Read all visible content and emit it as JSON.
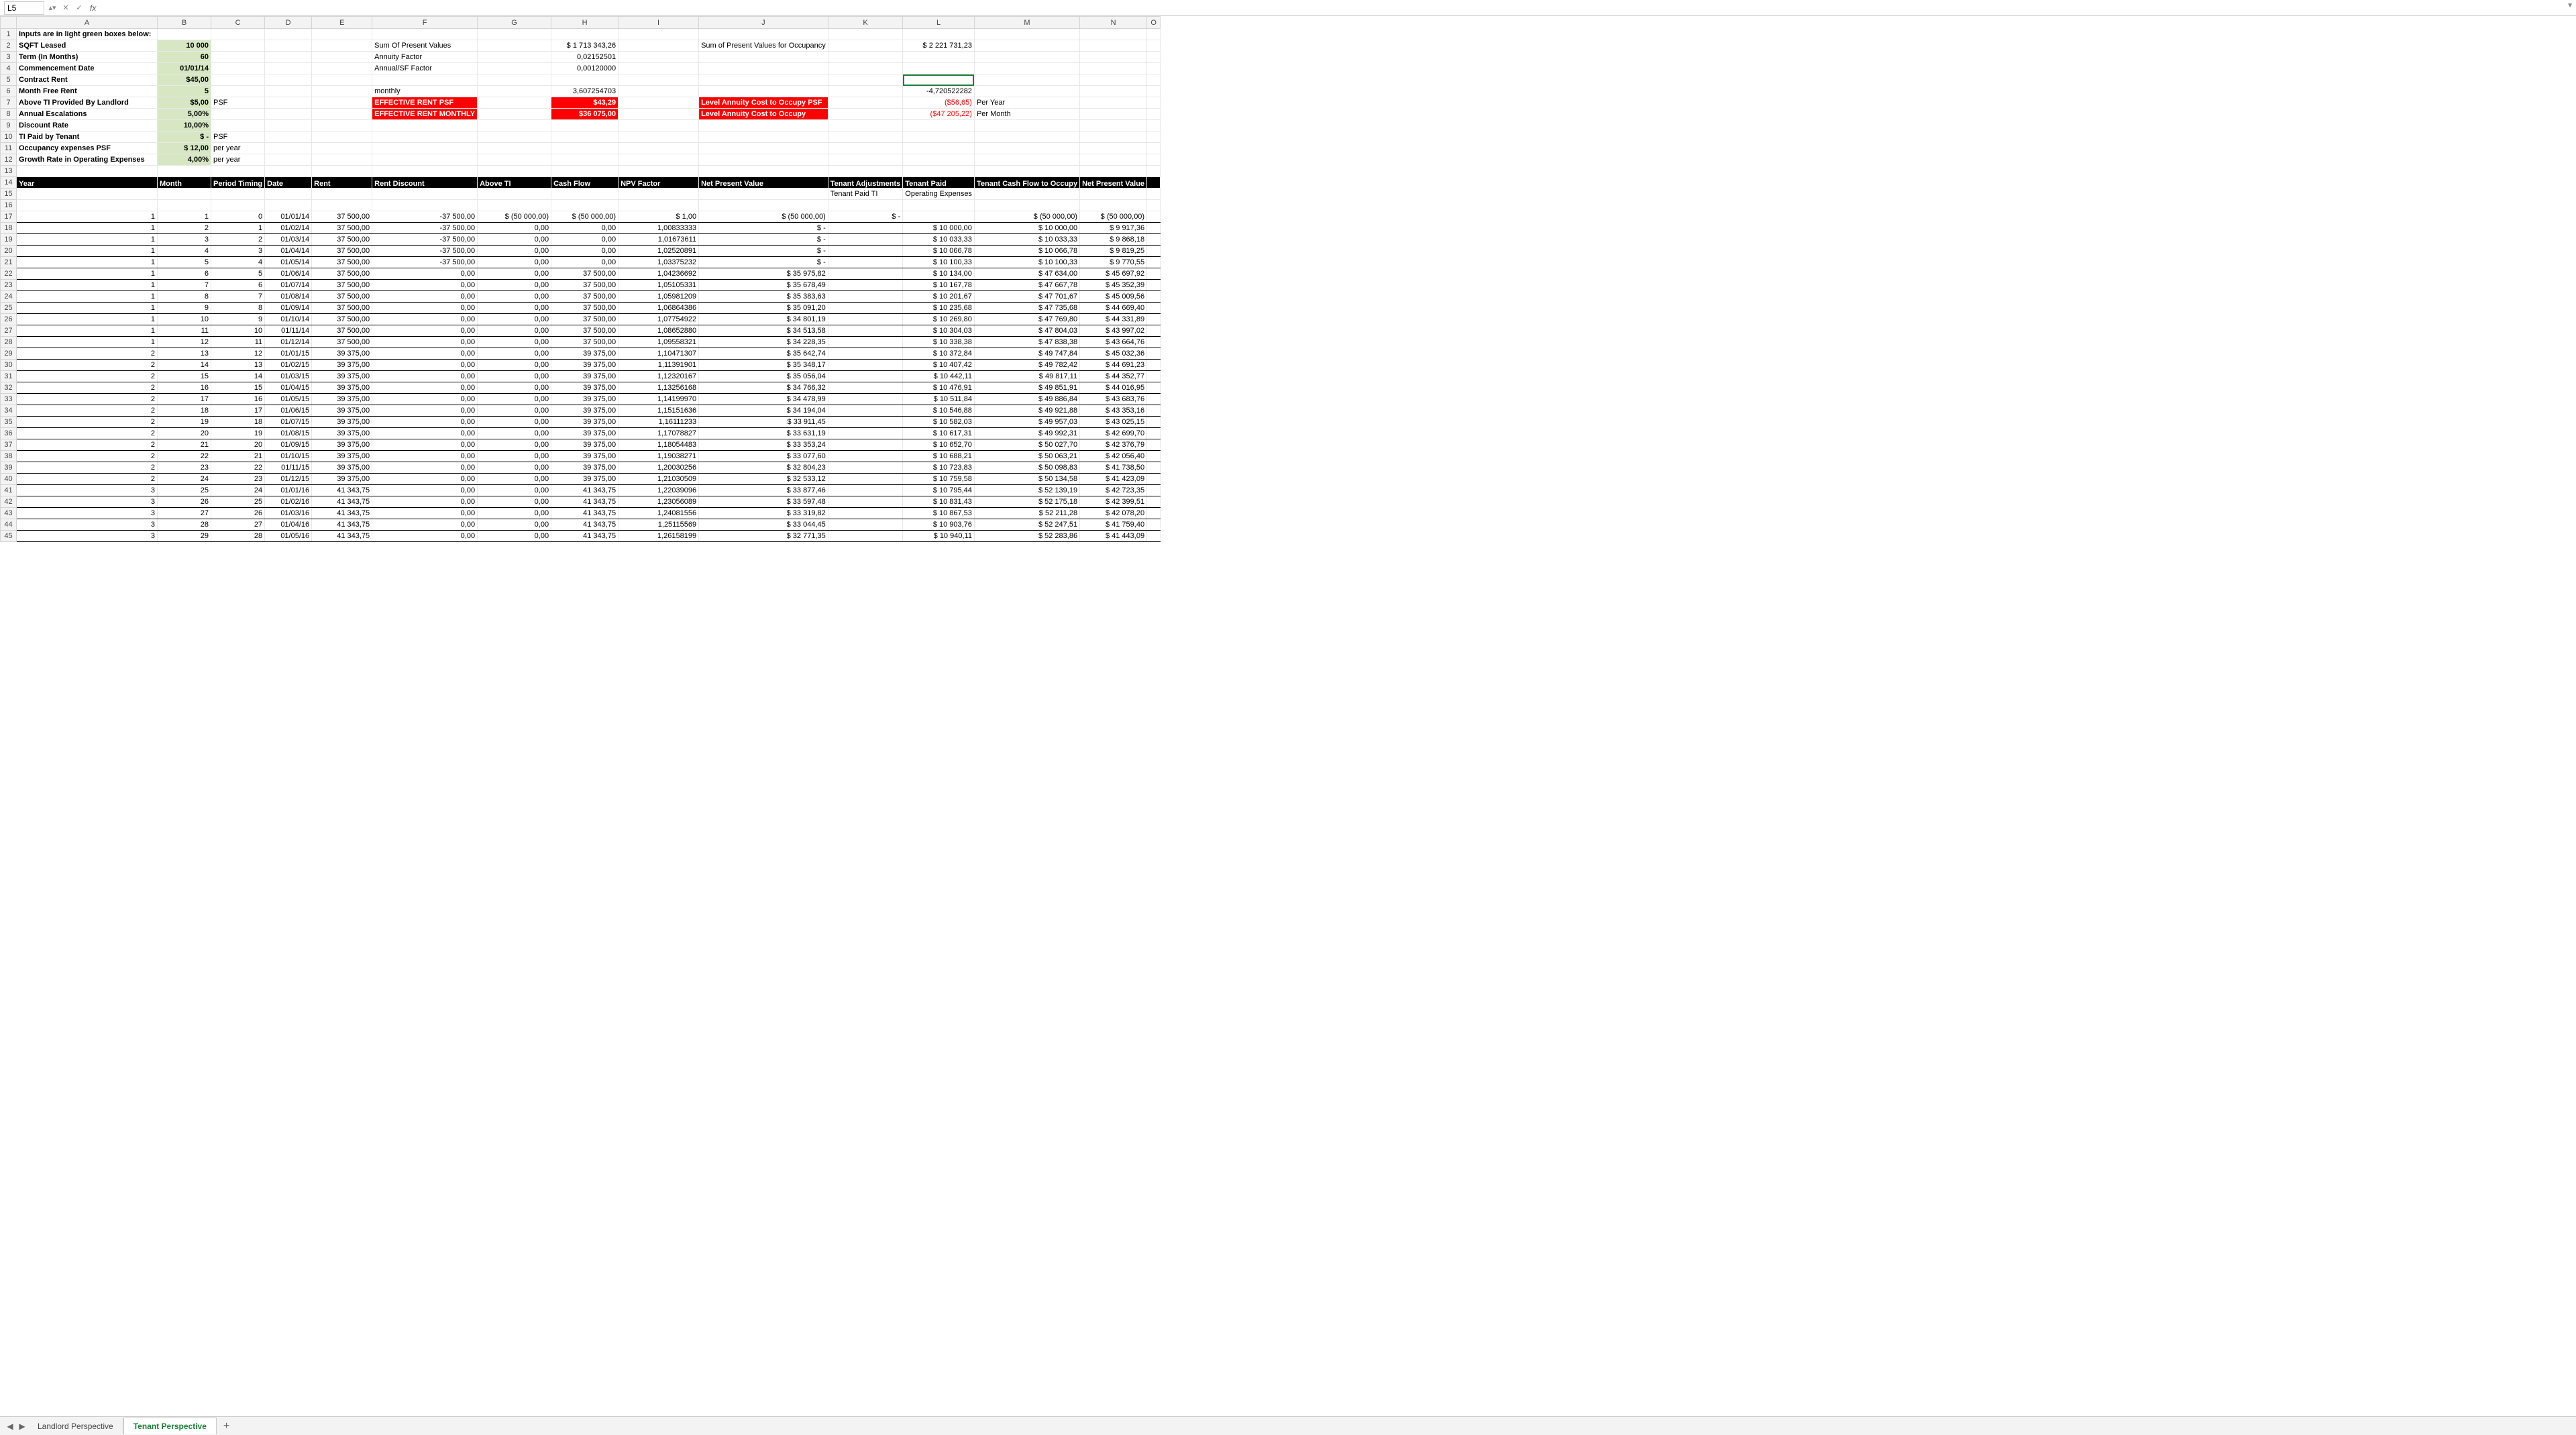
{
  "activeCellRef": "L5",
  "columns": [
    "A",
    "B",
    "C",
    "D",
    "E",
    "F",
    "G",
    "H",
    "I",
    "J",
    "K",
    "L",
    "M",
    "N",
    "O"
  ],
  "tabs": {
    "t1": "Landlord Perspective",
    "t2": "Tenant Perspective"
  },
  "inputs": {
    "title": "Inputs are in light green boxes below:",
    "rows": [
      {
        "label": "SQFT Leased",
        "val": "10 000",
        "unit": ""
      },
      {
        "label": "Term (In Months)",
        "val": "60",
        "unit": ""
      },
      {
        "label": "Commencement Date",
        "val": "01/01/14",
        "unit": ""
      },
      {
        "label": "Contract Rent",
        "val": "$45,00",
        "unit": ""
      },
      {
        "label": "Month Free Rent",
        "val": "5",
        "unit": ""
      },
      {
        "label": "Above TI Provided By Landlord",
        "val": "$5,00",
        "unit": "PSF"
      },
      {
        "label": "Annual Escalations",
        "val": "5,00%",
        "unit": ""
      },
      {
        "label": "Discount Rate",
        "val": "10,00%",
        "unit": ""
      },
      {
        "label": "TI Paid by Tenant",
        "val": "$       -",
        "unit": "PSF"
      },
      {
        "label": "Occupancy expenses PSF",
        "val": "$    12,00",
        "unit": "per year"
      },
      {
        "label": "Growth Rate in Operating Expenses",
        "val": "4,00%",
        "unit": "per year"
      }
    ]
  },
  "summary": {
    "sumPV_lbl": "Sum Of Present Values",
    "sumPV_val": "$    1 713 343,26",
    "annFac_lbl": "Annuity Factor",
    "annFac_val": "0,02152501",
    "annSF_lbl": "Annual/SF Factor",
    "annSF_val": "0,00120000",
    "monthly_lbl": "monthly",
    "monthly_val": "3,607254703",
    "effPSF_lbl": "EFFECTIVE RENT PSF",
    "effPSF_val": "$43,29",
    "effMon_lbl": "EFFECTIVE RENT MONTHLY",
    "effMon_val": "$36 075,00",
    "occPV_lbl": "Sum of Present Values for Occupancy",
    "occPV_val": "$    2 221 731,23",
    "neg_val": "-4,720522282",
    "lacPSF_lbl": "Level Annuity Cost to Occupy PSF",
    "lacPSF_val": "($56,65)",
    "lacPSF_unit": "Per Year",
    "lac_lbl": "Level Annuity Cost to Occupy",
    "lac_val": "($47 205,22)",
    "lac_unit": "Per Month"
  },
  "headers": {
    "year": "Year",
    "month": "Month",
    "period": "Period Timing",
    "date": "Date",
    "rent": "Rent",
    "rentDisc": "Rent Discount",
    "aboveTI": "Above TI",
    "cashFlow": "Cash Flow",
    "npvFac": "NPV Factor",
    "npv": "Net Present Value",
    "tenantAdj": "Tenant Adjustments",
    "tenantPaid": "Tenant Paid",
    "cfOccupy": "Tenant Cash Flow to Occupy",
    "netPV": "Net Present Value",
    "sub1": "Tenant Paid TI",
    "sub2": "Operating Expenses"
  },
  "rows": [
    {
      "r": 17,
      "y": "1",
      "m": "1",
      "p": "0",
      "d": "01/01/14",
      "rent": "37 500,00",
      "disc": "-37 500,00",
      "ti": "$       (50 000,00)",
      "cf": "$     (50 000,00)",
      "npvf": "$          1,00",
      "npv": "$              (50 000,00)",
      "adj": "$            -",
      "paid": "",
      "cfo": "$              (50 000,00)",
      "pv": "$    (50 000,00)"
    },
    {
      "r": 18,
      "y": "1",
      "m": "2",
      "p": "1",
      "d": "01/02/14",
      "rent": "37 500,00",
      "disc": "-37 500,00",
      "ti": "0,00",
      "cf": "0,00",
      "npvf": "1,00833333",
      "npv": "$                              -",
      "adj": "",
      "paid": "$             10 000,00",
      "cfo": "$               10 000,00",
      "pv": "$       9 917,36"
    },
    {
      "r": 19,
      "y": "1",
      "m": "3",
      "p": "2",
      "d": "01/03/14",
      "rent": "37 500,00",
      "disc": "-37 500,00",
      "ti": "0,00",
      "cf": "0,00",
      "npvf": "1,01673611",
      "npv": "$                              -",
      "adj": "",
      "paid": "$             10 033,33",
      "cfo": "$               10 033,33",
      "pv": "$       9 868,18"
    },
    {
      "r": 20,
      "y": "1",
      "m": "4",
      "p": "3",
      "d": "01/04/14",
      "rent": "37 500,00",
      "disc": "-37 500,00",
      "ti": "0,00",
      "cf": "0,00",
      "npvf": "1,02520891",
      "npv": "$                              -",
      "adj": "",
      "paid": "$             10 066,78",
      "cfo": "$               10 066,78",
      "pv": "$       9 819,25"
    },
    {
      "r": 21,
      "y": "1",
      "m": "5",
      "p": "4",
      "d": "01/05/14",
      "rent": "37 500,00",
      "disc": "-37 500,00",
      "ti": "0,00",
      "cf": "0,00",
      "npvf": "1,03375232",
      "npv": "$                              -",
      "adj": "",
      "paid": "$             10 100,33",
      "cfo": "$               10 100,33",
      "pv": "$       9 770,55"
    },
    {
      "r": 22,
      "y": "1",
      "m": "6",
      "p": "5",
      "d": "01/06/14",
      "rent": "37 500,00",
      "disc": "0,00",
      "ti": "0,00",
      "cf": "37 500,00",
      "npvf": "1,04236692",
      "npv": "$                 35 975,82",
      "adj": "",
      "paid": "$             10 134,00",
      "cfo": "$               47 634,00",
      "pv": "$     45 697,92"
    },
    {
      "r": 23,
      "y": "1",
      "m": "7",
      "p": "6",
      "d": "01/07/14",
      "rent": "37 500,00",
      "disc": "0,00",
      "ti": "0,00",
      "cf": "37 500,00",
      "npvf": "1,05105331",
      "npv": "$                 35 678,49",
      "adj": "",
      "paid": "$             10 167,78",
      "cfo": "$               47 667,78",
      "pv": "$     45 352,39"
    },
    {
      "r": 24,
      "y": "1",
      "m": "8",
      "p": "7",
      "d": "01/08/14",
      "rent": "37 500,00",
      "disc": "0,00",
      "ti": "0,00",
      "cf": "37 500,00",
      "npvf": "1,05981209",
      "npv": "$                 35 383,63",
      "adj": "",
      "paid": "$             10 201,67",
      "cfo": "$               47 701,67",
      "pv": "$     45 009,56"
    },
    {
      "r": 25,
      "y": "1",
      "m": "9",
      "p": "8",
      "d": "01/09/14",
      "rent": "37 500,00",
      "disc": "0,00",
      "ti": "0,00",
      "cf": "37 500,00",
      "npvf": "1,06864386",
      "npv": "$                 35 091,20",
      "adj": "",
      "paid": "$             10 235,68",
      "cfo": "$               47 735,68",
      "pv": "$     44 669,40"
    },
    {
      "r": 26,
      "y": "1",
      "m": "10",
      "p": "9",
      "d": "01/10/14",
      "rent": "37 500,00",
      "disc": "0,00",
      "ti": "0,00",
      "cf": "37 500,00",
      "npvf": "1,07754922",
      "npv": "$                 34 801,19",
      "adj": "",
      "paid": "$             10 269,80",
      "cfo": "$               47 769,80",
      "pv": "$     44 331,89"
    },
    {
      "r": 27,
      "y": "1",
      "m": "11",
      "p": "10",
      "d": "01/11/14",
      "rent": "37 500,00",
      "disc": "0,00",
      "ti": "0,00",
      "cf": "37 500,00",
      "npvf": "1,08652880",
      "npv": "$                 34 513,58",
      "adj": "",
      "paid": "$             10 304,03",
      "cfo": "$               47 804,03",
      "pv": "$     43 997,02"
    },
    {
      "r": 28,
      "y": "1",
      "m": "12",
      "p": "11",
      "d": "01/12/14",
      "rent": "37 500,00",
      "disc": "0,00",
      "ti": "0,00",
      "cf": "37 500,00",
      "npvf": "1,09558321",
      "npv": "$                 34 228,35",
      "adj": "",
      "paid": "$             10 338,38",
      "cfo": "$               47 838,38",
      "pv": "$     43 664,76"
    },
    {
      "r": 29,
      "y": "2",
      "m": "13",
      "p": "12",
      "d": "01/01/15",
      "rent": "39 375,00",
      "disc": "0,00",
      "ti": "0,00",
      "cf": "39 375,00",
      "npvf": "1,10471307",
      "npv": "$                 35 642,74",
      "adj": "",
      "paid": "$             10 372,84",
      "cfo": "$               49 747,84",
      "pv": "$     45 032,36"
    },
    {
      "r": 30,
      "y": "2",
      "m": "14",
      "p": "13",
      "d": "01/02/15",
      "rent": "39 375,00",
      "disc": "0,00",
      "ti": "0,00",
      "cf": "39 375,00",
      "npvf": "1,11391901",
      "npv": "$                 35 348,17",
      "adj": "",
      "paid": "$             10 407,42",
      "cfo": "$               49 782,42",
      "pv": "$     44 691,23"
    },
    {
      "r": 31,
      "y": "2",
      "m": "15",
      "p": "14",
      "d": "01/03/15",
      "rent": "39 375,00",
      "disc": "0,00",
      "ti": "0,00",
      "cf": "39 375,00",
      "npvf": "1,12320167",
      "npv": "$                 35 056,04",
      "adj": "",
      "paid": "$             10 442,11",
      "cfo": "$               49 817,11",
      "pv": "$     44 352,77"
    },
    {
      "r": 32,
      "y": "2",
      "m": "16",
      "p": "15",
      "d": "01/04/15",
      "rent": "39 375,00",
      "disc": "0,00",
      "ti": "0,00",
      "cf": "39 375,00",
      "npvf": "1,13256168",
      "npv": "$                 34 766,32",
      "adj": "",
      "paid": "$             10 476,91",
      "cfo": "$               49 851,91",
      "pv": "$     44 016,95"
    },
    {
      "r": 33,
      "y": "2",
      "m": "17",
      "p": "16",
      "d": "01/05/15",
      "rent": "39 375,00",
      "disc": "0,00",
      "ti": "0,00",
      "cf": "39 375,00",
      "npvf": "1,14199970",
      "npv": "$                 34 478,99",
      "adj": "",
      "paid": "$             10 511,84",
      "cfo": "$               49 886,84",
      "pv": "$     43 683,76"
    },
    {
      "r": 34,
      "y": "2",
      "m": "18",
      "p": "17",
      "d": "01/06/15",
      "rent": "39 375,00",
      "disc": "0,00",
      "ti": "0,00",
      "cf": "39 375,00",
      "npvf": "1,15151636",
      "npv": "$                 34 194,04",
      "adj": "",
      "paid": "$             10 546,88",
      "cfo": "$               49 921,88",
      "pv": "$     43 353,16"
    },
    {
      "r": 35,
      "y": "2",
      "m": "19",
      "p": "18",
      "d": "01/07/15",
      "rent": "39 375,00",
      "disc": "0,00",
      "ti": "0,00",
      "cf": "39 375,00",
      "npvf": "1,16111233",
      "npv": "$                 33 911,45",
      "adj": "",
      "paid": "$             10 582,03",
      "cfo": "$               49 957,03",
      "pv": "$     43 025,15"
    },
    {
      "r": 36,
      "y": "2",
      "m": "20",
      "p": "19",
      "d": "01/08/15",
      "rent": "39 375,00",
      "disc": "0,00",
      "ti": "0,00",
      "cf": "39 375,00",
      "npvf": "1,17078827",
      "npv": "$                 33 631,19",
      "adj": "",
      "paid": "$             10 617,31",
      "cfo": "$               49 992,31",
      "pv": "$     42 699,70"
    },
    {
      "r": 37,
      "y": "2",
      "m": "21",
      "p": "20",
      "d": "01/09/15",
      "rent": "39 375,00",
      "disc": "0,00",
      "ti": "0,00",
      "cf": "39 375,00",
      "npvf": "1,18054483",
      "npv": "$                 33 353,24",
      "adj": "",
      "paid": "$             10 652,70",
      "cfo": "$               50 027,70",
      "pv": "$     42 376,79"
    },
    {
      "r": 38,
      "y": "2",
      "m": "22",
      "p": "21",
      "d": "01/10/15",
      "rent": "39 375,00",
      "disc": "0,00",
      "ti": "0,00",
      "cf": "39 375,00",
      "npvf": "1,19038271",
      "npv": "$                 33 077,60",
      "adj": "",
      "paid": "$             10 688,21",
      "cfo": "$               50 063,21",
      "pv": "$     42 056,40"
    },
    {
      "r": 39,
      "y": "2",
      "m": "23",
      "p": "22",
      "d": "01/11/15",
      "rent": "39 375,00",
      "disc": "0,00",
      "ti": "0,00",
      "cf": "39 375,00",
      "npvf": "1,20030256",
      "npv": "$                 32 804,23",
      "adj": "",
      "paid": "$             10 723,83",
      "cfo": "$               50 098,83",
      "pv": "$     41 738,50"
    },
    {
      "r": 40,
      "y": "2",
      "m": "24",
      "p": "23",
      "d": "01/12/15",
      "rent": "39 375,00",
      "disc": "0,00",
      "ti": "0,00",
      "cf": "39 375,00",
      "npvf": "1,21030509",
      "npv": "$                 32 533,12",
      "adj": "",
      "paid": "$             10 759,58",
      "cfo": "$               50 134,58",
      "pv": "$     41 423,09"
    },
    {
      "r": 41,
      "y": "3",
      "m": "25",
      "p": "24",
      "d": "01/01/16",
      "rent": "41 343,75",
      "disc": "0,00",
      "ti": "0,00",
      "cf": "41 343,75",
      "npvf": "1,22039096",
      "npv": "$                 33 877,46",
      "adj": "",
      "paid": "$             10 795,44",
      "cfo": "$               52 139,19",
      "pv": "$     42 723,35"
    },
    {
      "r": 42,
      "y": "3",
      "m": "26",
      "p": "25",
      "d": "01/02/16",
      "rent": "41 343,75",
      "disc": "0,00",
      "ti": "0,00",
      "cf": "41 343,75",
      "npvf": "1,23056089",
      "npv": "$                 33 597,48",
      "adj": "",
      "paid": "$             10 831,43",
      "cfo": "$               52 175,18",
      "pv": "$     42 399,51"
    },
    {
      "r": 43,
      "y": "3",
      "m": "27",
      "p": "26",
      "d": "01/03/16",
      "rent": "41 343,75",
      "disc": "0,00",
      "ti": "0,00",
      "cf": "41 343,75",
      "npvf": "1,24081556",
      "npv": "$                 33 319,82",
      "adj": "",
      "paid": "$             10 867,53",
      "cfo": "$               52 211,28",
      "pv": "$     42 078,20"
    },
    {
      "r": 44,
      "y": "3",
      "m": "28",
      "p": "27",
      "d": "01/04/16",
      "rent": "41 343,75",
      "disc": "0,00",
      "ti": "0,00",
      "cf": "41 343,75",
      "npvf": "1,25115569",
      "npv": "$                 33 044,45",
      "adj": "",
      "paid": "$             10 903,76",
      "cfo": "$               52 247,51",
      "pv": "$     41 759,40"
    },
    {
      "r": 45,
      "y": "3",
      "m": "29",
      "p": "28",
      "d": "01/05/16",
      "rent": "41 343,75",
      "disc": "0,00",
      "ti": "0,00",
      "cf": "41 343,75",
      "npvf": "1,26158199",
      "npv": "$                 32 771,35",
      "adj": "",
      "paid": "$             10 940,11",
      "cfo": "$               52 283,86",
      "pv": "$     41 443,09"
    }
  ]
}
